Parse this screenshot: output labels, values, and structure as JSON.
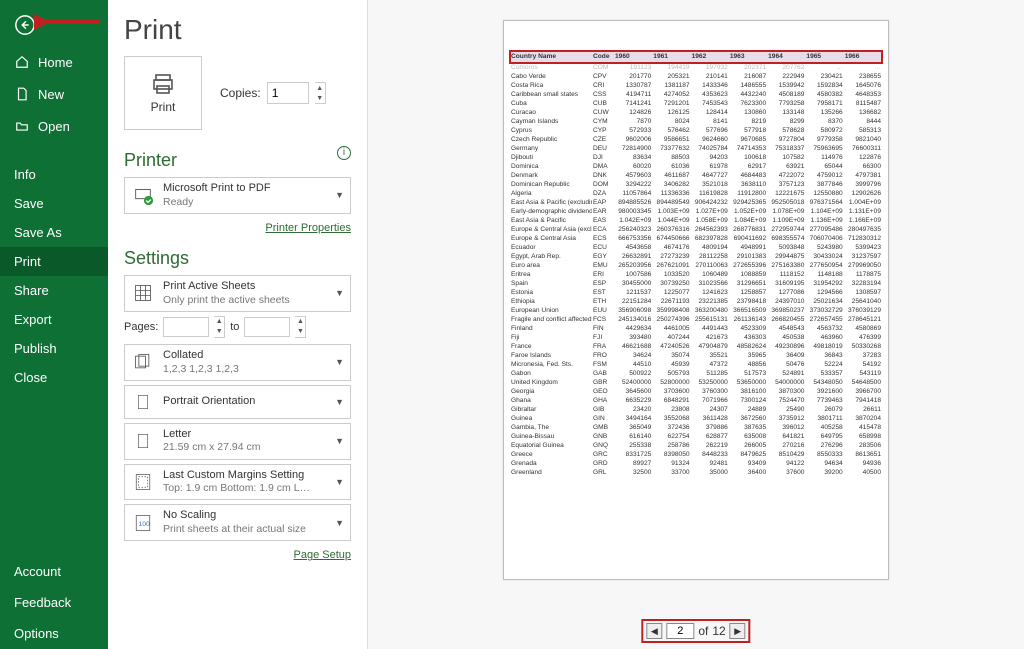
{
  "sidebar": {
    "items": [
      {
        "label": "Home",
        "icon": "home-icon"
      },
      {
        "label": "New",
        "icon": "new-icon"
      },
      {
        "label": "Open",
        "icon": "open-icon"
      }
    ],
    "items2": [
      {
        "label": "Info"
      },
      {
        "label": "Save"
      },
      {
        "label": "Save As"
      },
      {
        "label": "Print",
        "selected": true
      },
      {
        "label": "Share"
      },
      {
        "label": "Export"
      },
      {
        "label": "Publish"
      },
      {
        "label": "Close"
      }
    ],
    "items3": [
      {
        "label": "Account"
      },
      {
        "label": "Feedback"
      },
      {
        "label": "Options"
      }
    ]
  },
  "center": {
    "title": "Print",
    "print_button": "Print",
    "copies_label": "Copies:",
    "copies_value": "1",
    "printer_header": "Printer",
    "printer_name": "Microsoft Print to PDF",
    "printer_status": "Ready",
    "printer_properties": "Printer Properties",
    "settings_header": "Settings",
    "opt_sheets_title": "Print Active Sheets",
    "opt_sheets_sub": "Only print the active sheets",
    "pages_label": "Pages:",
    "pages_to": "to",
    "opt_collated_title": "Collated",
    "opt_collated_sub": "1,2,3   1,2,3   1,2,3",
    "opt_orientation": "Portrait Orientation",
    "opt_paper_title": "Letter",
    "opt_paper_sub": "21.59 cm x 27.94 cm",
    "opt_margins_title": "Last Custom Margins Setting",
    "opt_margins_sub": "Top: 1.9 cm Bottom: 1.9 cm L…",
    "opt_scaling_title": "No Scaling",
    "opt_scaling_sub": "Print sheets at their actual size",
    "page_setup": "Page Setup"
  },
  "pager": {
    "current": "2",
    "of_label": "of",
    "total": "12"
  },
  "table": {
    "headers": [
      "Country Name",
      "Code",
      "1960",
      "1961",
      "1962",
      "1963",
      "1964",
      "1965",
      "1966"
    ],
    "cutoff_row": [
      "Comoros",
      "COM",
      "191123",
      "194419",
      "197932",
      "202371",
      "207762",
      "…",
      "…"
    ],
    "rows": [
      [
        "Cabo Verde",
        "CPV",
        "201770",
        "205321",
        "210141",
        "216087",
        "222949",
        "230421",
        "238655"
      ],
      [
        "Costa Rica",
        "CRI",
        "1330787",
        "1381187",
        "1433346",
        "1486555",
        "1539942",
        "1592834",
        "1645076"
      ],
      [
        "Caribbean small states",
        "CSS",
        "4194711",
        "4274052",
        "4353623",
        "4432240",
        "4508189",
        "4580382",
        "4648353"
      ],
      [
        "Cuba",
        "CUB",
        "7141241",
        "7291201",
        "7453543",
        "7623300",
        "7793258",
        "7958171",
        "8115487"
      ],
      [
        "Curacao",
        "CUW",
        "124826",
        "126125",
        "128414",
        "130860",
        "133148",
        "135266",
        "136682"
      ],
      [
        "Cayman Islands",
        "CYM",
        "7870",
        "8024",
        "8141",
        "8219",
        "8299",
        "8370",
        "8444"
      ],
      [
        "Cyprus",
        "CYP",
        "572933",
        "576462",
        "577696",
        "577918",
        "578628",
        "580972",
        "585313"
      ],
      [
        "Czech Republic",
        "CZE",
        "9602006",
        "9586651",
        "9624660",
        "9670685",
        "9727804",
        "9779358",
        "9821040"
      ],
      [
        "Germany",
        "DEU",
        "72814900",
        "73377632",
        "74025784",
        "74714353",
        "75318337",
        "75963695",
        "76600311"
      ],
      [
        "Djibouti",
        "DJI",
        "83634",
        "88503",
        "94203",
        "100618",
        "107582",
        "114976",
        "122876"
      ],
      [
        "Dominica",
        "DMA",
        "60020",
        "61036",
        "61978",
        "62917",
        "63921",
        "65044",
        "66300"
      ],
      [
        "Denmark",
        "DNK",
        "4579603",
        "4611687",
        "4647727",
        "4684483",
        "4722072",
        "4759012",
        "4797381"
      ],
      [
        "Dominican Republic",
        "DOM",
        "3294222",
        "3406282",
        "3521018",
        "3638110",
        "3757123",
        "3877846",
        "3999796"
      ],
      [
        "Algeria",
        "DZA",
        "11057864",
        "11336336",
        "11619828",
        "11912800",
        "12221675",
        "12550880",
        "12902626"
      ],
      [
        "East Asia & Pacific (excluding I",
        "EAP",
        "894885526",
        "894489549",
        "906424232",
        "929425365",
        "952505018",
        "976371564",
        "1.004E+09"
      ],
      [
        "Early-demographic dividend",
        "EAR",
        "980003345",
        "1.003E+09",
        "1.027E+09",
        "1.052E+09",
        "1.078E+09",
        "1.104E+09",
        "1.131E+09"
      ],
      [
        "East Asia & Pacific",
        "EAS",
        "1.042E+09",
        "1.044E+09",
        "1.058E+09",
        "1.084E+09",
        "1.109E+09",
        "1.136E+09",
        "1.166E+09"
      ],
      [
        "Europe & Central Asia (exclud",
        "ECA",
        "256240323",
        "260376316",
        "264562393",
        "268776831",
        "272959744",
        "277095486",
        "280497635"
      ],
      [
        "Europe & Central Asia",
        "ECS",
        "666753356",
        "674450666",
        "682397828",
        "690411692",
        "698355574",
        "706070406",
        "712830312"
      ],
      [
        "Ecuador",
        "ECU",
        "4543658",
        "4674176",
        "4809194",
        "4948991",
        "5093848",
        "5243980",
        "5399423"
      ],
      [
        "Egypt, Arab Rep.",
        "EGY",
        "26632891",
        "27273239",
        "28112258",
        "29101383",
        "29944875",
        "30433024",
        "31237597"
      ],
      [
        "Euro area",
        "EMU",
        "265203956",
        "267621091",
        "270110063",
        "272655396",
        "275163380",
        "277650954",
        "279969050"
      ],
      [
        "Eritrea",
        "ERI",
        "1007586",
        "1033520",
        "1060489",
        "1088859",
        "1118152",
        "1148188",
        "1178875"
      ],
      [
        "Spain",
        "ESP",
        "30455000",
        "30739250",
        "31023566",
        "31296651",
        "31609195",
        "31954292",
        "32283194"
      ],
      [
        "Estonia",
        "EST",
        "1211537",
        "1225077",
        "1241623",
        "1258857",
        "1277086",
        "1294566",
        "1308597"
      ],
      [
        "Ethiopia",
        "ETH",
        "22151284",
        "22671193",
        "23221385",
        "23798418",
        "24397010",
        "25021634",
        "25641040"
      ],
      [
        "European Union",
        "EUU",
        "356906098",
        "359998408",
        "363200480",
        "366516509",
        "369850237",
        "373032729",
        "376039129"
      ],
      [
        "Fragile and conflict affected si",
        "FCS",
        "245134016",
        "250274396",
        "255615131",
        "261136143",
        "266820455",
        "272657455",
        "278645121"
      ],
      [
        "Finland",
        "FIN",
        "4429634",
        "4461005",
        "4491443",
        "4523309",
        "4548543",
        "4563732",
        "4580869"
      ],
      [
        "Fiji",
        "FJI",
        "393480",
        "407244",
        "421673",
        "436303",
        "450538",
        "463960",
        "476399"
      ],
      [
        "France",
        "FRA",
        "46621688",
        "47240526",
        "47904879",
        "48582624",
        "49230896",
        "49818019",
        "50330268"
      ],
      [
        "Faroe Islands",
        "FRO",
        "34624",
        "35074",
        "35521",
        "35965",
        "36409",
        "36843",
        "37283"
      ],
      [
        "Micronesia, Fed. Sts.",
        "FSM",
        "44510",
        "45939",
        "47372",
        "48856",
        "50476",
        "52224",
        "54192"
      ],
      [
        "Gabon",
        "GAB",
        "500922",
        "505793",
        "511285",
        "517573",
        "524891",
        "533357",
        "543119"
      ],
      [
        "United Kingdom",
        "GBR",
        "52400000",
        "52800000",
        "53250000",
        "53650000",
        "54000000",
        "54348050",
        "54648500"
      ],
      [
        "Georgia",
        "GEO",
        "3645600",
        "3703600",
        "3760300",
        "3816100",
        "3870300",
        "3921600",
        "3966700"
      ],
      [
        "Ghana",
        "GHA",
        "6635229",
        "6848291",
        "7071966",
        "7300124",
        "7524470",
        "7739463",
        "7941418"
      ],
      [
        "Gibraltar",
        "GIB",
        "23420",
        "23808",
        "24307",
        "24889",
        "25490",
        "26079",
        "26611"
      ],
      [
        "Guinea",
        "GIN",
        "3494164",
        "3552068",
        "3611428",
        "3672560",
        "3735912",
        "3801711",
        "3870204"
      ],
      [
        "Gambia, The",
        "GMB",
        "365049",
        "372436",
        "379886",
        "387635",
        "396012",
        "405258",
        "415478"
      ],
      [
        "Guinea-Bissau",
        "GNB",
        "616140",
        "622754",
        "628877",
        "635008",
        "641821",
        "649795",
        "658998"
      ],
      [
        "Equatorial Guinea",
        "GNQ",
        "255338",
        "258786",
        "262219",
        "266005",
        "270216",
        "276296",
        "283506"
      ],
      [
        "Greece",
        "GRC",
        "8331725",
        "8398050",
        "8448233",
        "8479625",
        "8510429",
        "8550333",
        "8613651"
      ],
      [
        "Grenada",
        "GRD",
        "89927",
        "91324",
        "92481",
        "93409",
        "94122",
        "94634",
        "94936"
      ],
      [
        "Greenland",
        "GRL",
        "32500",
        "33700",
        "35000",
        "36400",
        "37600",
        "39200",
        "40500"
      ]
    ]
  }
}
